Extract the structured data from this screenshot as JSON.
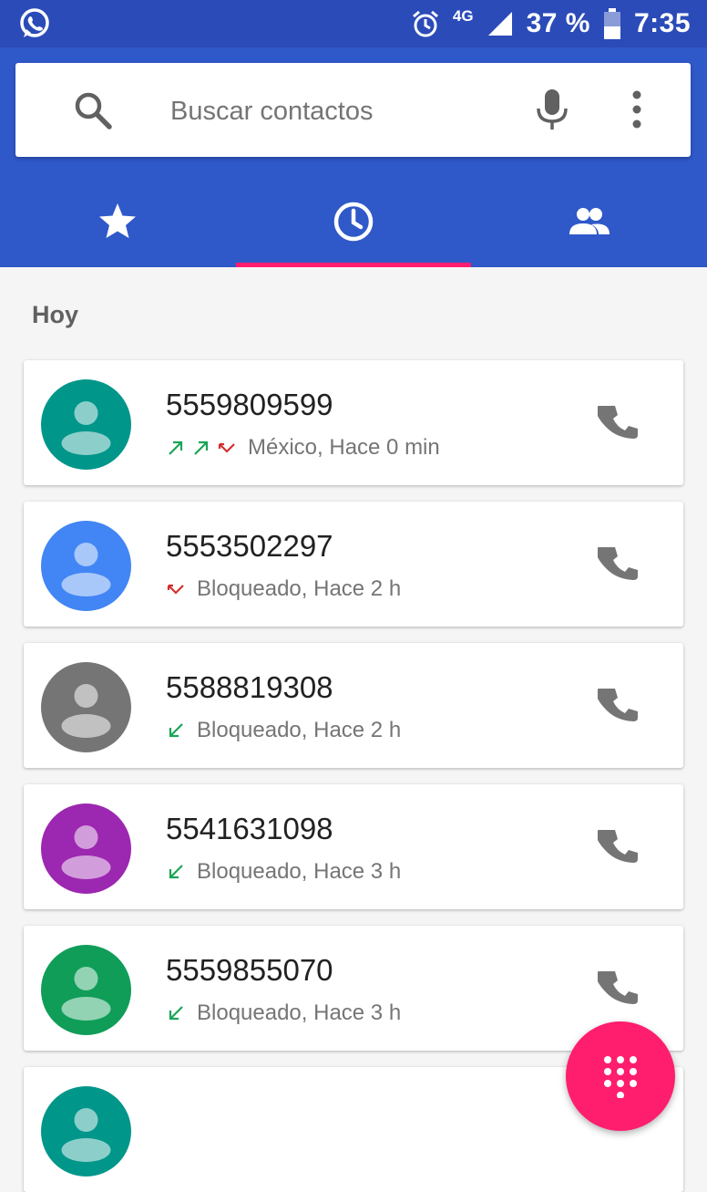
{
  "status_bar": {
    "network": "4G",
    "battery": "37 %",
    "time": "7:35",
    "icons": [
      "whatsapp-icon",
      "alarm-icon",
      "signal-icon",
      "battery-icon"
    ]
  },
  "search": {
    "placeholder": "Buscar contactos"
  },
  "tabs": [
    {
      "icon": "star-icon",
      "selected": false
    },
    {
      "icon": "clock-icon",
      "selected": true
    },
    {
      "icon": "people-icon",
      "selected": false
    }
  ],
  "section_title": "Hoy",
  "colors": {
    "appbar": "#2f58c9",
    "statusbar": "#2b4bb8",
    "accent": "#ff1d6e",
    "outgoing": "#1aa557",
    "missed": "#d32f2f"
  },
  "calls": [
    {
      "number": "5559809599",
      "detail": "México, Hace 0 min",
      "arrows": [
        "outgoing",
        "outgoing",
        "missed"
      ],
      "avatar_color": "#00968a"
    },
    {
      "number": "5553502297",
      "detail": "Bloqueado, Hace 2 h",
      "arrows": [
        "missed"
      ],
      "avatar_color": "#4285f4"
    },
    {
      "number": "5588819308",
      "detail": "Bloqueado, Hace 2 h",
      "arrows": [
        "incoming"
      ],
      "avatar_color": "#757575"
    },
    {
      "number": "5541631098",
      "detail": "Bloqueado, Hace 3 h",
      "arrows": [
        "incoming"
      ],
      "avatar_color": "#9c27b0"
    },
    {
      "number": "5559855070",
      "detail": "Bloqueado, Hace 3 h",
      "arrows": [
        "incoming"
      ],
      "avatar_color": "#0f9d58"
    }
  ],
  "partial_avatar_color": "#00968a"
}
